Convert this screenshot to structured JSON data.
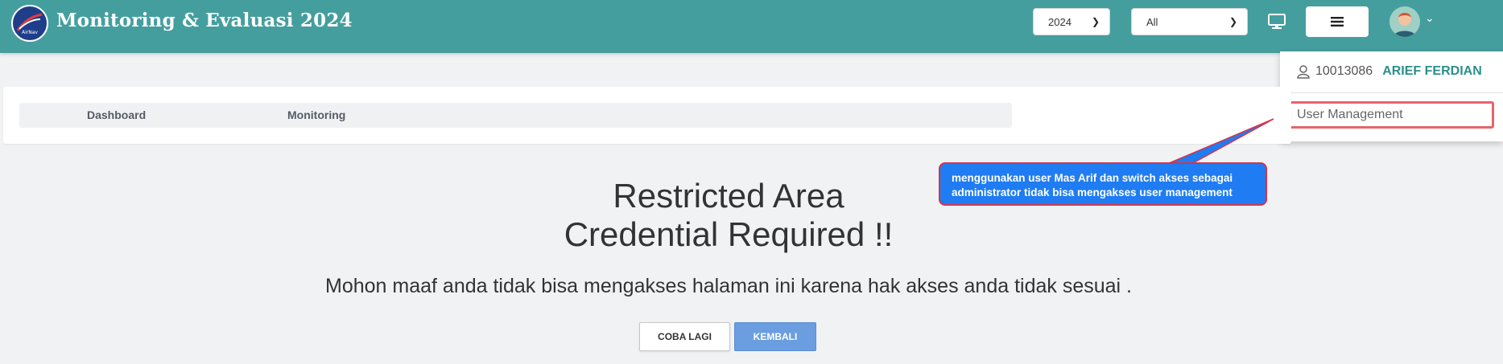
{
  "header": {
    "app_title": "Monitoring & Evaluasi 2024",
    "year_select": {
      "value": "2024"
    },
    "filter_select": {
      "value": "All"
    },
    "brand_color": "#459e9e"
  },
  "user_menu": {
    "user_id": "10013086",
    "user_name": "ARIEF FERDIAN",
    "items": [
      {
        "label": "User Management"
      }
    ]
  },
  "nav": {
    "items": [
      {
        "label": "Dashboard"
      },
      {
        "label": "Monitoring"
      }
    ]
  },
  "annotation": {
    "line1": "menggunakan user Mas Arif dan switch akses sebagai",
    "line2": "administrator tidak bisa mengakses user management"
  },
  "main": {
    "title_line1": "Restricted Area",
    "title_line2": "Credential Required !!",
    "message": "Mohon maaf anda tidak bisa mengakses halaman ini karena hak akses anda tidak sesuai .",
    "retry_label": "COBA LAGI",
    "back_label": "KEMBALI"
  },
  "icons": [
    "logo-icon",
    "monitor-icon",
    "hamburger-menu-icon",
    "avatar-icon",
    "chevron-down-icon",
    "user-outline-icon"
  ]
}
